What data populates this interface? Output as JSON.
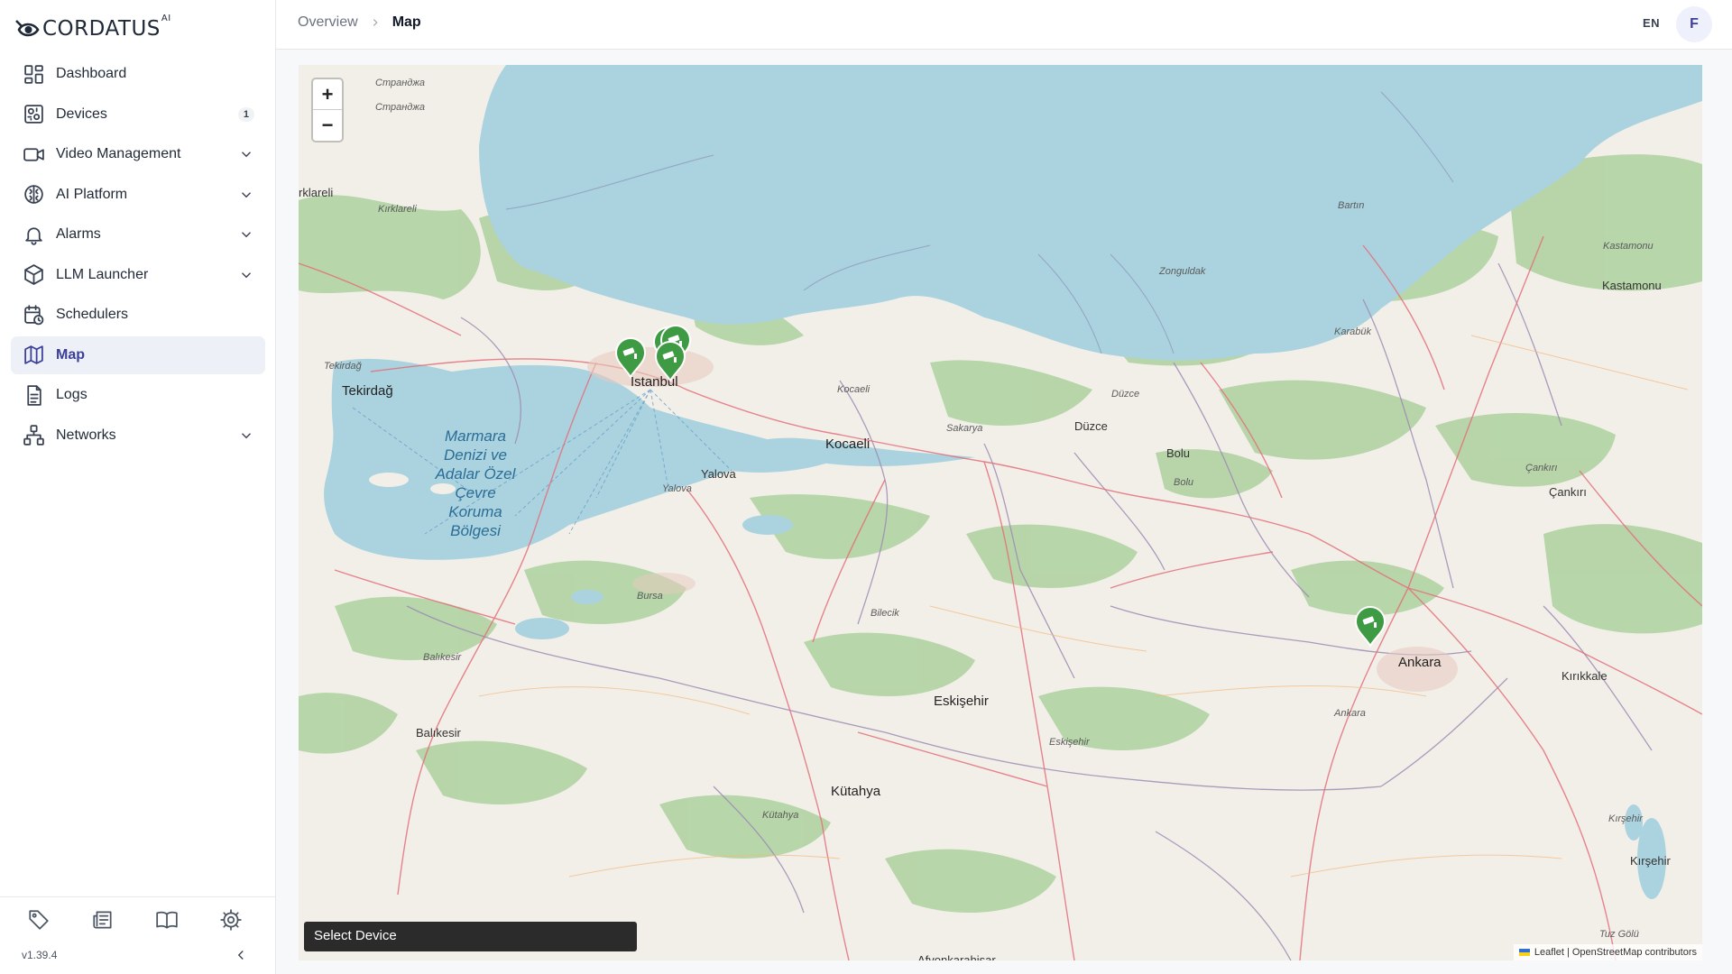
{
  "brand": {
    "name": "CORDATUS",
    "sup": "AI"
  },
  "sidebar": {
    "items": [
      {
        "label": "Dashboard",
        "icon": "dashboard-icon",
        "badge": "",
        "expandable": false,
        "active": false
      },
      {
        "label": "Devices",
        "icon": "devices-icon",
        "badge": "1",
        "expandable": false,
        "active": false
      },
      {
        "label": "Video Management",
        "icon": "video-camera-icon",
        "badge": "",
        "expandable": true,
        "active": false
      },
      {
        "label": "AI Platform",
        "icon": "brain-icon",
        "badge": "",
        "expandable": true,
        "active": false
      },
      {
        "label": "Alarms",
        "icon": "bell-icon",
        "badge": "",
        "expandable": true,
        "active": false
      },
      {
        "label": "LLM Launcher",
        "icon": "cube-icon",
        "badge": "",
        "expandable": true,
        "active": false
      },
      {
        "label": "Schedulers",
        "icon": "calendar-clock-icon",
        "badge": "",
        "expandable": false,
        "active": false
      },
      {
        "label": "Map",
        "icon": "map-icon",
        "badge": "",
        "expandable": false,
        "active": true
      },
      {
        "label": "Logs",
        "icon": "document-icon",
        "badge": "",
        "expandable": false,
        "active": false
      },
      {
        "label": "Networks",
        "icon": "network-icon",
        "badge": "",
        "expandable": true,
        "active": false
      }
    ],
    "bottom_icons": [
      "tag-icon",
      "newspaper-icon",
      "book-icon",
      "gear-icon"
    ],
    "version": "v1.39.4"
  },
  "header": {
    "breadcrumb": [
      "Overview",
      "Map"
    ],
    "language": "EN",
    "avatar_initial": "F"
  },
  "map": {
    "zoom_in": "+",
    "zoom_out": "−",
    "select_device": "Select Device",
    "attribution": {
      "leaflet": "Leaflet",
      "sep": "|",
      "osm": "OpenStreetMap contributors"
    },
    "labels": {
      "istanbul": "İstanbul",
      "tekirdag": "Tekirdağ",
      "tekirdag_small": "Tekirdağ",
      "kirklareli": "Kırklareli",
      "kirklareli_edge": "rklareli",
      "marmara": "Marmara Denizi ve Adalar Özel Çevre Koruma Bölgesi",
      "yalova": "Yalova",
      "yalova_small": "Yalova",
      "kocaeli": "Kocaeli",
      "kocaeli_small": "Kocaeli",
      "sakarya": "Sakarya",
      "duzce": "Düzce",
      "duzce_small": "Düzce",
      "bolu": "Bolu",
      "bolu_small": "Bolu",
      "zonguldak": "Zonguldak",
      "bartin": "Bartın",
      "karabuk": "Karabük",
      "kastamonu": "Kastamonu",
      "kastamonu_small": "Kastamonu",
      "cankiri": "Çankırı",
      "cankiri_small": "Çankırı",
      "ankara": "Ankara",
      "ankara_small": "Ankara",
      "kirikkale": "Kırıkkale",
      "kirsehir": "Kırşehir",
      "kirsehir_small": "Kırşehir",
      "eskisehir": "Eskişehir",
      "eskisehir_small": "Eskişehir",
      "kutahya": "Kütahya",
      "kutahya_small": "Kütahya",
      "bilecik": "Bilecik",
      "bursa": "Bursa",
      "balikesir": "Balıkesir",
      "balikesir_small": "Balıkesir",
      "strandzha": "Странджа",
      "tuz_golu": "Tuz Gölü",
      "afyonkarahisar": "Afyonkarahisar"
    }
  },
  "colors": {
    "accent": "#3b3f98",
    "marker": "#3f9b43",
    "sea": "#aad3df",
    "land": "#f2efe9",
    "forest": "#add19e"
  }
}
